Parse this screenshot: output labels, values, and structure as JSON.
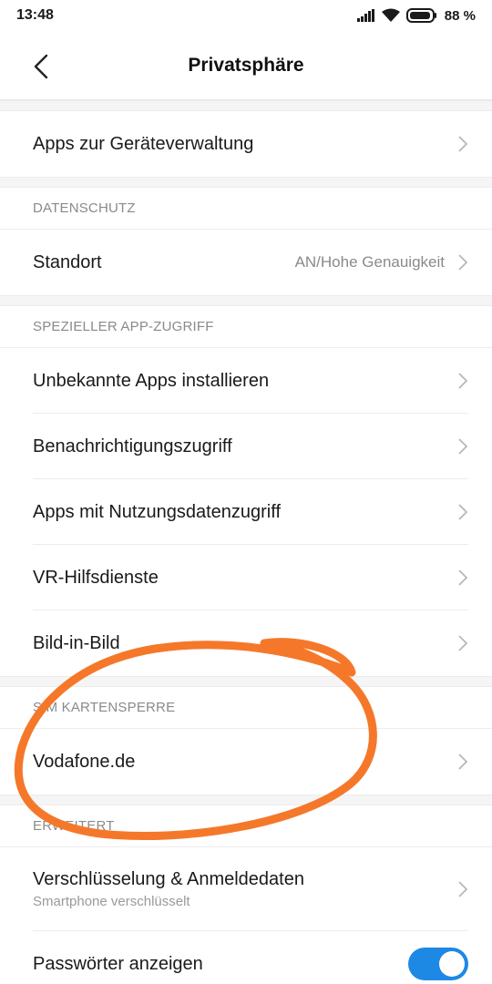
{
  "status": {
    "time": "13:48",
    "battery": "88 %"
  },
  "header": {
    "title": "Privatsphäre"
  },
  "top": {
    "items": [
      {
        "label": "Apps zur Geräteverwaltung"
      }
    ]
  },
  "datenschutz": {
    "header": "DATENSCHUTZ",
    "standort": {
      "label": "Standort",
      "value": "AN/Hohe Genauigkeit"
    }
  },
  "app_access": {
    "header": "SPEZIELLER APP-ZUGRIFF",
    "items": [
      {
        "label": "Unbekannte Apps installieren"
      },
      {
        "label": "Benachrichtigungszugriff"
      },
      {
        "label": "Apps mit Nutzungsdatenzugriff"
      },
      {
        "label": "VR-Hilfsdienste"
      },
      {
        "label": "Bild-in-Bild"
      }
    ]
  },
  "sim": {
    "header": "SIM KARTENSPERRE",
    "items": [
      {
        "label": "Vodafone.de"
      }
    ]
  },
  "advanced": {
    "header": "ERWEITERT",
    "encryption": {
      "label": "Verschlüsselung & Anmeldedaten",
      "sub": "Smartphone verschlüsselt"
    },
    "passwords": {
      "label": "Passwörter anzeigen",
      "enabled": true
    }
  },
  "colors": {
    "accent": "#1e88e5",
    "annotation": "#f5782a"
  }
}
